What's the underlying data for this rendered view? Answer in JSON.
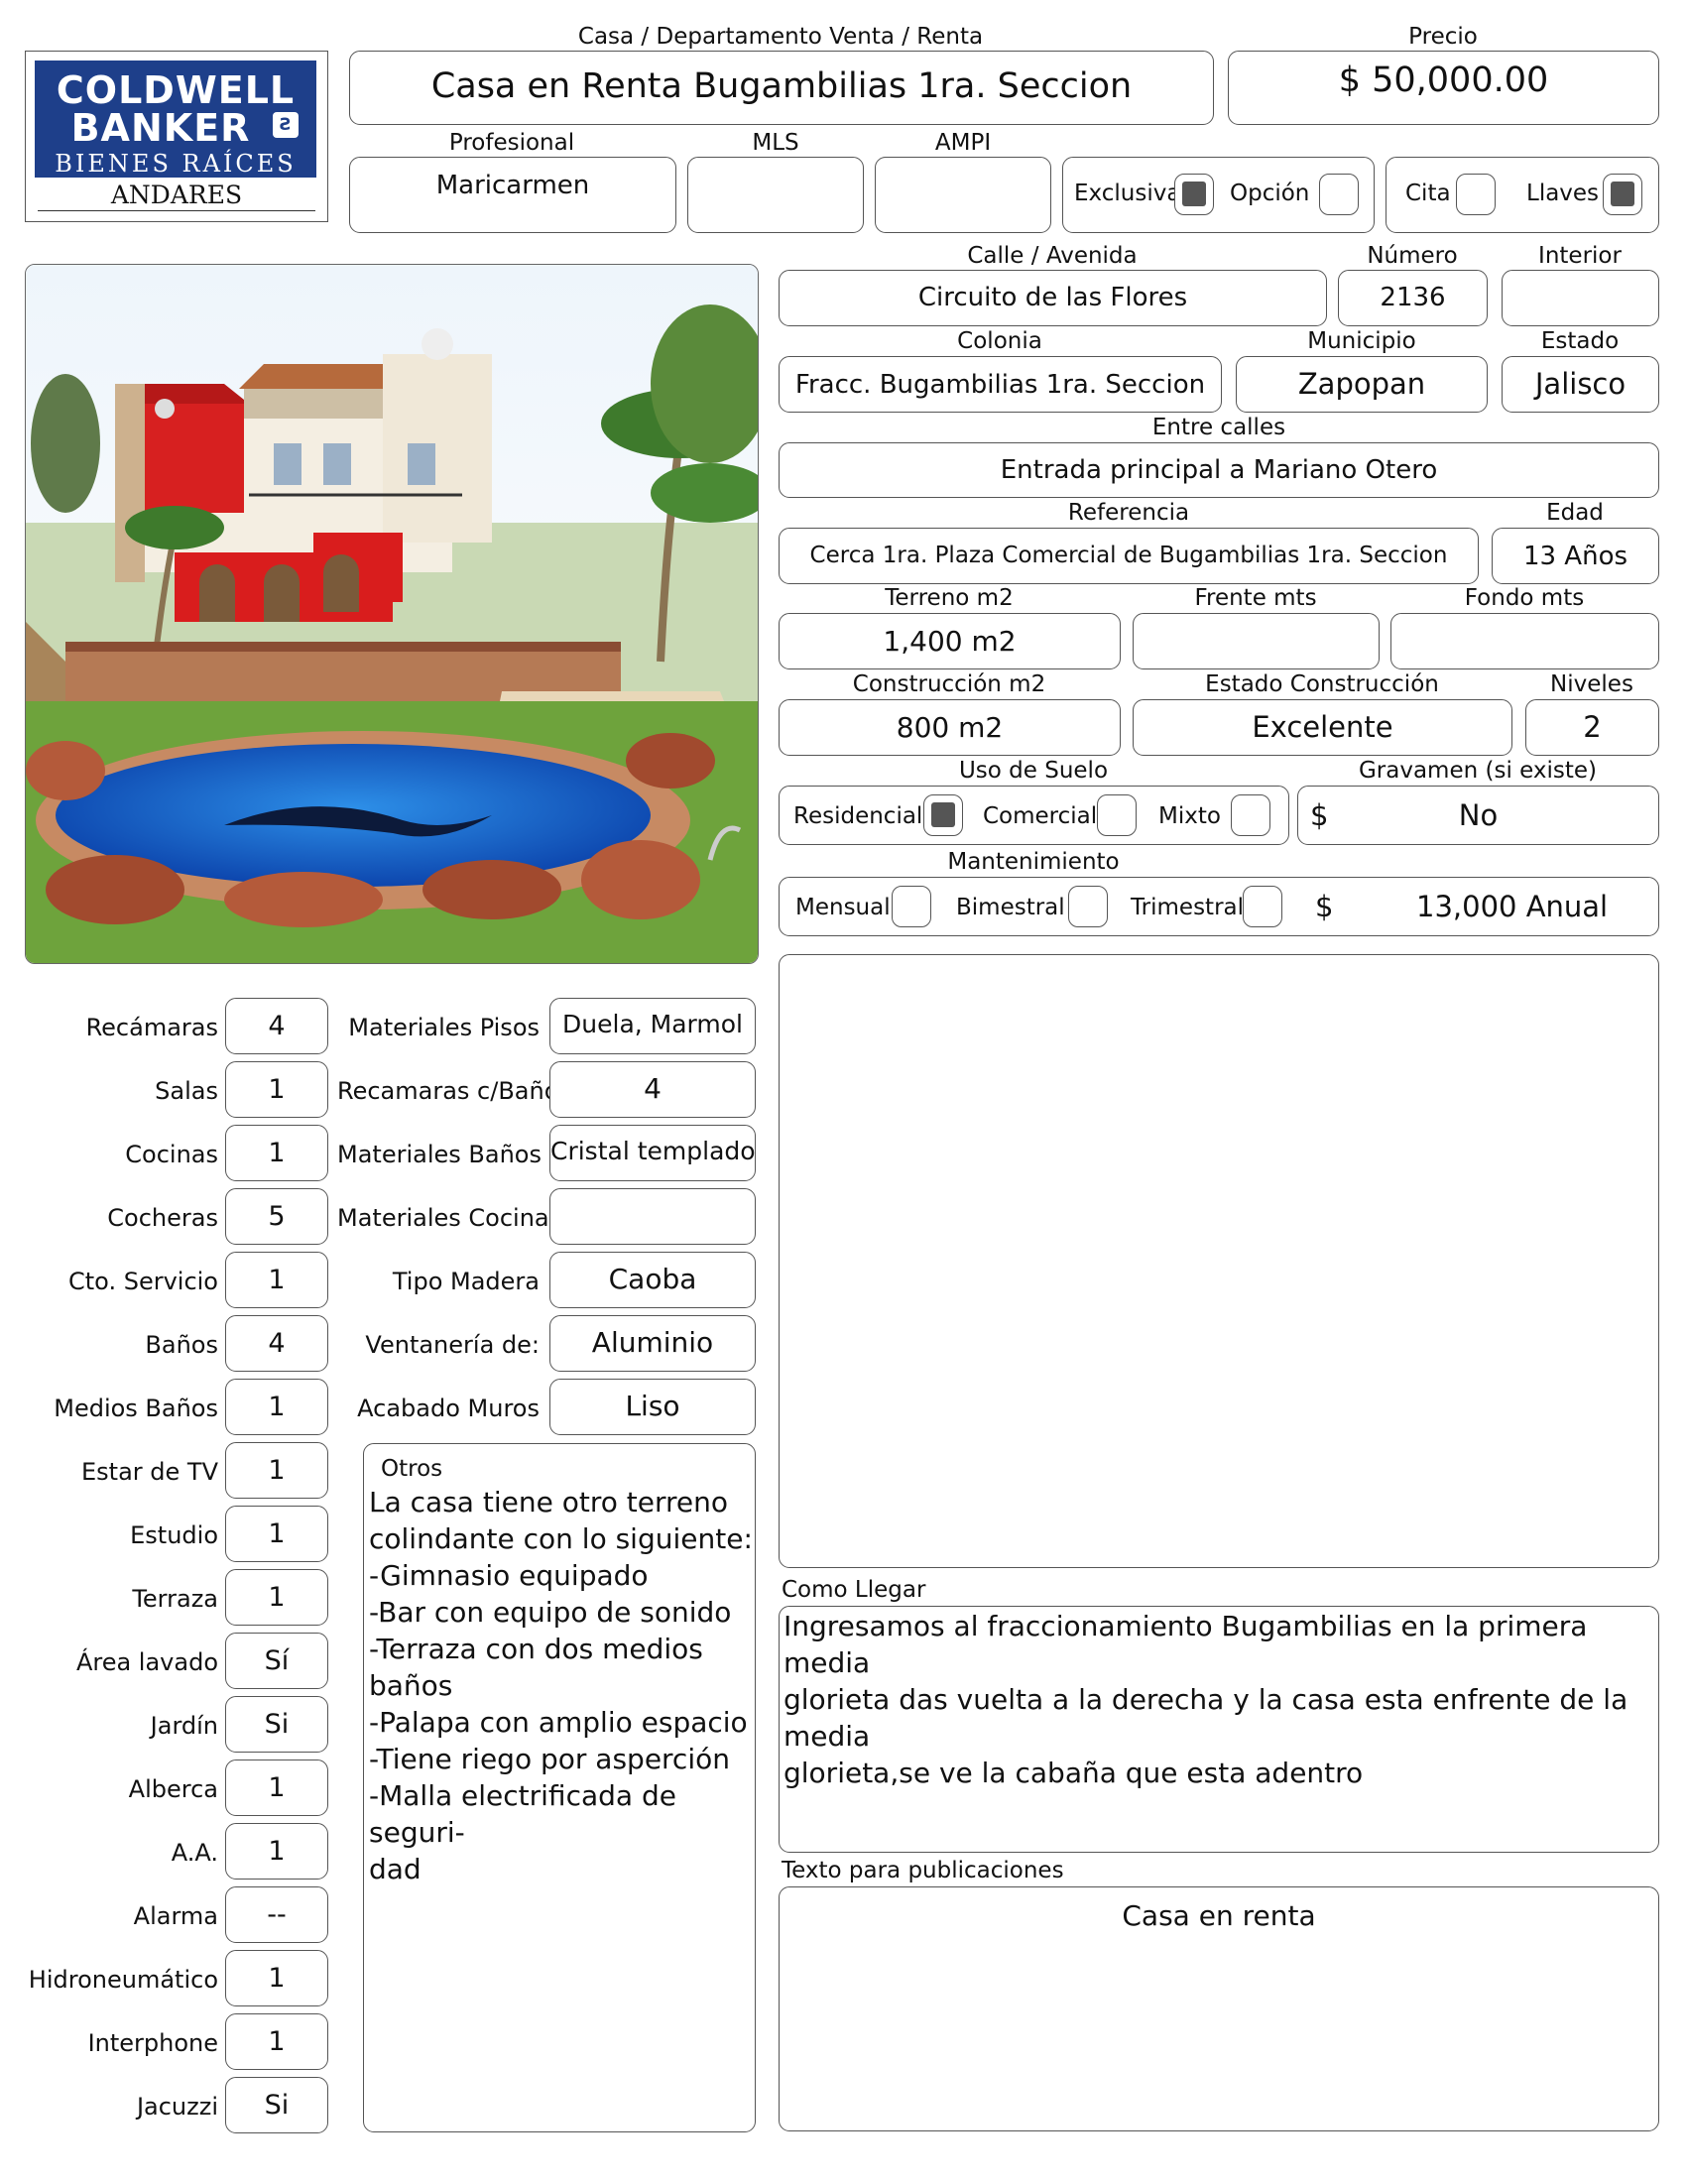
{
  "logo": {
    "line1": "COLDWELL",
    "line2": "BANKER",
    "line3": "BIENES RAÍCES",
    "line4": "ANDARES"
  },
  "labels": {
    "tipo": "Casa / Departamento   Venta / Renta",
    "precio": "Precio",
    "profesional": "Profesional",
    "mls": "MLS",
    "ampi": "AMPI",
    "exclusiva": "Exclusiva",
    "opcion": "Opción",
    "cita": "Cita",
    "llaves": "Llaves",
    "calle": "Calle / Avenida",
    "numero": "Número",
    "interior": "Interior",
    "colonia": "Colonia",
    "municipio": "Municipio",
    "estado": "Estado",
    "entre_calles": "Entre calles",
    "referencia": "Referencia",
    "edad": "Edad",
    "terreno": "Terreno m2",
    "frente": "Frente mts",
    "fondo": "Fondo mts",
    "construccion": "Construcción m2",
    "estado_construccion": "Estado Construcción",
    "niveles": "Niveles",
    "uso_suelo": "Uso de Suelo",
    "gravamen": "Gravamen (si existe)",
    "residencial": "Residencial",
    "comercial": "Comercial",
    "mixto": "Mixto",
    "mantenimiento": "Mantenimiento",
    "mensual": "Mensual",
    "bimestral": "Bimestral",
    "trimestral": "Trimestral",
    "dollar": "$",
    "otros": "Otros",
    "como_llegar": "Como Llegar",
    "texto_publicaciones": "Texto para publicaciones"
  },
  "values": {
    "titulo": "Casa en Renta Bugambilias 1ra. Seccion",
    "precio": "$ 50,000.00",
    "profesional": "Maricarmen",
    "mls": "",
    "ampi": "",
    "calle": "Circuito de las Flores",
    "numero": "2136",
    "interior": "",
    "colonia": "Fracc. Bugambilias 1ra. Seccion",
    "municipio": "Zapopan",
    "estado": "Jalisco",
    "entre_calles": "Entrada principal a Mariano Otero",
    "referencia": "Cerca 1ra. Plaza Comercial de Bugambilias 1ra. Seccion",
    "edad": "13 Años",
    "terreno": "1,400 m2",
    "frente": "",
    "fondo": "",
    "construccion": "800 m2",
    "estado_construccion": "Excelente",
    "niveles": "2",
    "gravamen": "No",
    "mantenimiento": "13,000 Anual",
    "otros": "La casa tiene otro terreno\ncolindante con lo siguiente:\n-Gimnasio equipado\n-Bar con equipo de sonido\n-Terraza con dos medios\nbaños\n-Palapa con amplio espacio\n-Tiene riego por asperción\n-Malla electrificada de seguri-\ndad",
    "como_llegar": "Ingresamos al fraccionamiento Bugambilias en la primera media\nglorieta das vuelta a la derecha y la casa esta enfrente de la media\nglorieta,se ve la cabaña que esta adentro",
    "texto_publicaciones": "Casa en renta"
  },
  "checks": {
    "exclusiva": true,
    "opcion": false,
    "cita": false,
    "llaves": true,
    "residencial": true,
    "comercial": false,
    "mixto": false,
    "mensual": false,
    "bimestral": false,
    "trimestral": false
  },
  "left_fields": [
    {
      "label": "Recámaras",
      "value": "4"
    },
    {
      "label": "Salas",
      "value": "1"
    },
    {
      "label": "Cocinas",
      "value": "1"
    },
    {
      "label": "Cocheras",
      "value": "5"
    },
    {
      "label": "Cto. Servicio",
      "value": "1"
    },
    {
      "label": "Baños",
      "value": "4"
    },
    {
      "label": "Medios Baños",
      "value": "1"
    },
    {
      "label": "Estar de TV",
      "value": "1"
    },
    {
      "label": "Estudio",
      "value": "1"
    },
    {
      "label": "Terraza",
      "value": "1"
    },
    {
      "label": "Área lavado",
      "value": "Sí"
    },
    {
      "label": "Jardín",
      "value": "Si"
    },
    {
      "label": "Alberca",
      "value": "1"
    },
    {
      "label": "A.A.",
      "value": "1"
    },
    {
      "label": "Alarma",
      "value": "--"
    },
    {
      "label": "Hidroneumático",
      "value": "1"
    },
    {
      "label": "Interphone",
      "value": "1"
    },
    {
      "label": "Jacuzzi",
      "value": "Si"
    }
  ],
  "mid_fields": [
    {
      "label": "Materiales Pisos",
      "value": "Duela, Marmol"
    },
    {
      "label": "Recamaras c/Baño",
      "value": "4"
    },
    {
      "label": "Materiales Baños",
      "value": "Cristal templado"
    },
    {
      "label": "Materiales Cocina",
      "value": ""
    },
    {
      "label": "Tipo Madera",
      "value": "Caoba"
    },
    {
      "label": "Ventanería de:",
      "value": "Aluminio"
    },
    {
      "label": "Acabado Muros",
      "value": "Liso"
    }
  ],
  "colors": {
    "brand": "#1e3f8a",
    "check_fill": "#555555",
    "border": "#555555"
  }
}
